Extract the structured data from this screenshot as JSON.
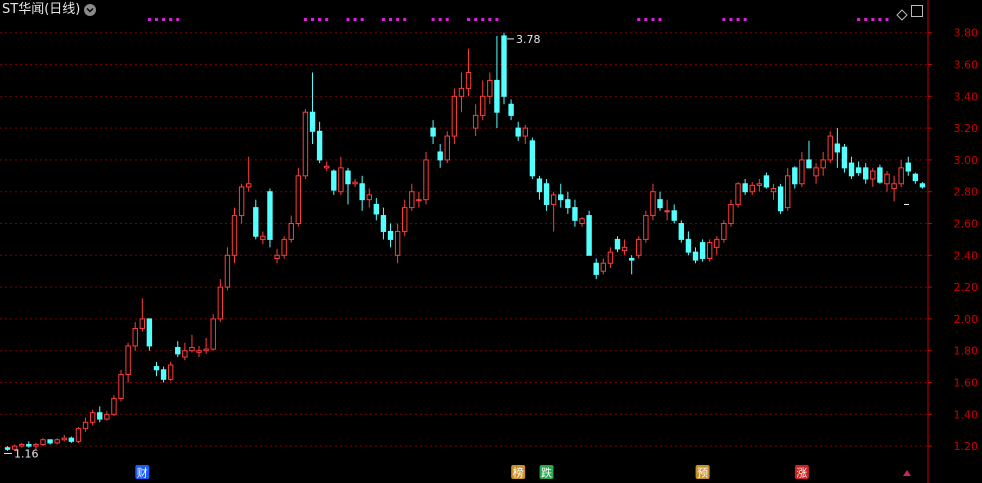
{
  "header": {
    "title": "ST华闻(日线)"
  },
  "colors": {
    "up": "#ff3c3c",
    "down": "#54ffff",
    "axis": "#cc0000",
    "grid": "#7a0000",
    "title": "#e6e6e6",
    "label": "#e6e6e6",
    "magenta": "#e020e0"
  },
  "chart_data": {
    "type": "candlestick",
    "title": "ST华闻(日线)",
    "ylim": [
      1.1,
      3.88
    ],
    "y_ticks": [
      "1.20",
      "1.40",
      "1.60",
      "1.80",
      "2.00",
      "2.20",
      "2.40",
      "2.60",
      "2.80",
      "3.00",
      "3.20",
      "3.40",
      "3.60",
      "3.80"
    ],
    "annotations": {
      "high_label": "3.78",
      "low_label": "1.16"
    },
    "event_markers": [
      "财",
      "榜",
      "跌",
      "预",
      "涨"
    ],
    "ohlc": [
      [
        1.19,
        1.2,
        1.17,
        1.18
      ],
      [
        1.18,
        1.21,
        1.17,
        1.2
      ],
      [
        1.2,
        1.22,
        1.19,
        1.21
      ],
      [
        1.21,
        1.23,
        1.19,
        1.2
      ],
      [
        1.2,
        1.22,
        1.18,
        1.21
      ],
      [
        1.21,
        1.25,
        1.2,
        1.24
      ],
      [
        1.24,
        1.23,
        1.21,
        1.22
      ],
      [
        1.22,
        1.25,
        1.21,
        1.24
      ],
      [
        1.24,
        1.27,
        1.23,
        1.25
      ],
      [
        1.25,
        1.26,
        1.22,
        1.23
      ],
      [
        1.23,
        1.32,
        1.22,
        1.31
      ],
      [
        1.31,
        1.38,
        1.29,
        1.35
      ],
      [
        1.35,
        1.43,
        1.33,
        1.41
      ],
      [
        1.41,
        1.45,
        1.35,
        1.37
      ],
      [
        1.37,
        1.42,
        1.36,
        1.4
      ],
      [
        1.4,
        1.52,
        1.39,
        1.5
      ],
      [
        1.5,
        1.68,
        1.48,
        1.65
      ],
      [
        1.65,
        1.85,
        1.6,
        1.83
      ],
      [
        1.83,
        1.98,
        1.8,
        1.94
      ],
      [
        1.94,
        2.13,
        1.92,
        2.0
      ],
      [
        2.0,
        1.95,
        1.8,
        1.83
      ],
      [
        1.7,
        1.73,
        1.64,
        1.68
      ],
      [
        1.68,
        1.7,
        1.6,
        1.62
      ],
      [
        1.62,
        1.73,
        1.61,
        1.71
      ],
      [
        1.82,
        1.86,
        1.76,
        1.78
      ],
      [
        1.76,
        1.85,
        1.74,
        1.8
      ],
      [
        1.8,
        1.9,
        1.79,
        1.82
      ],
      [
        1.79,
        1.83,
        1.76,
        1.8
      ],
      [
        1.8,
        1.88,
        1.78,
        1.81
      ],
      [
        1.81,
        2.03,
        1.8,
        2.0
      ],
      [
        2.0,
        2.25,
        1.98,
        2.2
      ],
      [
        2.2,
        2.45,
        2.18,
        2.4
      ],
      [
        2.4,
        2.7,
        2.35,
        2.65
      ],
      [
        2.65,
        2.85,
        2.6,
        2.83
      ],
      [
        2.83,
        3.02,
        2.8,
        2.85
      ],
      [
        2.7,
        2.75,
        2.5,
        2.52
      ],
      [
        2.5,
        2.55,
        2.47,
        2.52
      ],
      [
        2.8,
        2.82,
        2.45,
        2.5
      ],
      [
        2.38,
        2.44,
        2.35,
        2.4
      ],
      [
        2.4,
        2.52,
        2.38,
        2.5
      ],
      [
        2.5,
        2.65,
        2.48,
        2.6
      ],
      [
        2.6,
        2.95,
        2.58,
        2.9
      ],
      [
        2.9,
        3.32,
        2.88,
        3.3
      ],
      [
        3.3,
        3.55,
        3.1,
        3.18
      ],
      [
        3.18,
        3.24,
        2.98,
        3.0
      ],
      [
        2.95,
        2.99,
        2.93,
        2.96
      ],
      [
        2.93,
        2.94,
        2.78,
        2.81
      ],
      [
        2.8,
        3.02,
        2.78,
        2.95
      ],
      [
        2.93,
        2.95,
        2.72,
        2.85
      ],
      [
        2.85,
        2.88,
        2.83,
        2.86
      ],
      [
        2.85,
        2.9,
        2.68,
        2.75
      ],
      [
        2.75,
        2.82,
        2.7,
        2.78
      ],
      [
        2.72,
        2.76,
        2.62,
        2.66
      ],
      [
        2.65,
        2.7,
        2.5,
        2.55
      ],
      [
        2.55,
        2.6,
        2.45,
        2.5
      ],
      [
        2.4,
        2.6,
        2.35,
        2.55
      ],
      [
        2.55,
        2.75,
        2.52,
        2.7
      ],
      [
        2.7,
        2.85,
        2.68,
        2.8
      ],
      [
        2.75,
        2.8,
        2.7,
        2.75
      ],
      [
        2.75,
        3.05,
        2.72,
        3.0
      ],
      [
        3.2,
        3.25,
        3.1,
        3.15
      ],
      [
        3.05,
        3.1,
        2.95,
        3.0
      ],
      [
        3.0,
        3.18,
        2.98,
        3.15
      ],
      [
        3.15,
        3.45,
        3.1,
        3.4
      ],
      [
        3.4,
        3.55,
        3.3,
        3.45
      ],
      [
        3.45,
        3.7,
        3.4,
        3.55
      ],
      [
        3.2,
        3.35,
        3.15,
        3.28
      ],
      [
        3.28,
        3.5,
        3.25,
        3.4
      ],
      [
        3.4,
        3.55,
        3.35,
        3.5
      ],
      [
        3.5,
        3.78,
        3.2,
        3.3
      ],
      [
        3.78,
        3.8,
        3.35,
        3.4
      ],
      [
        3.35,
        3.38,
        3.25,
        3.28
      ],
      [
        3.2,
        3.24,
        3.12,
        3.15
      ],
      [
        3.15,
        3.22,
        3.1,
        3.2
      ],
      [
        3.12,
        3.14,
        2.88,
        2.9
      ],
      [
        2.88,
        2.9,
        2.75,
        2.8
      ],
      [
        2.85,
        2.88,
        2.68,
        2.72
      ],
      [
        2.72,
        2.8,
        2.55,
        2.78
      ],
      [
        2.78,
        2.85,
        2.7,
        2.75
      ],
      [
        2.75,
        2.8,
        2.66,
        2.7
      ],
      [
        2.7,
        2.75,
        2.58,
        2.62
      ],
      [
        2.6,
        2.64,
        2.58,
        2.63
      ],
      [
        2.65,
        2.68,
        2.4,
        2.4
      ],
      [
        2.35,
        2.38,
        2.25,
        2.28
      ],
      [
        2.3,
        2.38,
        2.28,
        2.35
      ],
      [
        2.35,
        2.45,
        2.32,
        2.42
      ],
      [
        2.5,
        2.52,
        2.42,
        2.44
      ],
      [
        2.43,
        2.5,
        2.4,
        2.45
      ],
      [
        2.38,
        2.4,
        2.28,
        2.37
      ],
      [
        2.4,
        2.52,
        2.38,
        2.5
      ],
      [
        2.5,
        2.68,
        2.48,
        2.65
      ],
      [
        2.65,
        2.85,
        2.62,
        2.8
      ],
      [
        2.75,
        2.8,
        2.68,
        2.7
      ],
      [
        2.68,
        2.75,
        2.62,
        2.68
      ],
      [
        2.68,
        2.72,
        2.6,
        2.62
      ],
      [
        2.6,
        2.62,
        2.48,
        2.5
      ],
      [
        2.5,
        2.55,
        2.4,
        2.42
      ],
      [
        2.42,
        2.45,
        2.35,
        2.37
      ],
      [
        2.48,
        2.5,
        2.36,
        2.38
      ],
      [
        2.38,
        2.5,
        2.36,
        2.48
      ],
      [
        2.45,
        2.52,
        2.4,
        2.5
      ],
      [
        2.5,
        2.62,
        2.48,
        2.6
      ],
      [
        2.6,
        2.75,
        2.58,
        2.72
      ],
      [
        2.72,
        2.86,
        2.7,
        2.85
      ],
      [
        2.85,
        2.88,
        2.78,
        2.8
      ],
      [
        2.8,
        2.86,
        2.78,
        2.84
      ],
      [
        2.84,
        2.88,
        2.8,
        2.85
      ],
      [
        2.9,
        2.92,
        2.82,
        2.83
      ],
      [
        2.8,
        2.85,
        2.75,
        2.82
      ],
      [
        2.83,
        2.85,
        2.66,
        2.68
      ],
      [
        2.7,
        2.95,
        2.68,
        2.9
      ],
      [
        2.95,
        2.96,
        2.82,
        2.85
      ],
      [
        2.85,
        3.05,
        2.83,
        3.0
      ],
      [
        3.0,
        3.12,
        2.95,
        2.95
      ],
      [
        2.9,
        2.98,
        2.85,
        2.95
      ],
      [
        2.95,
        3.05,
        2.9,
        3.0
      ],
      [
        3.0,
        3.18,
        2.98,
        3.15
      ],
      [
        3.1,
        3.2,
        2.95,
        3.05
      ],
      [
        3.08,
        3.1,
        2.92,
        2.95
      ],
      [
        2.98,
        3.02,
        2.88,
        2.9
      ],
      [
        2.95,
        2.99,
        2.9,
        2.92
      ],
      [
        2.95,
        2.98,
        2.85,
        2.88
      ],
      [
        2.88,
        2.95,
        2.83,
        2.93
      ],
      [
        2.95,
        2.97,
        2.85,
        2.86
      ],
      [
        2.85,
        2.93,
        2.8,
        2.91
      ],
      [
        2.82,
        2.9,
        2.74,
        2.85
      ],
      [
        2.85,
        3.0,
        2.83,
        2.95
      ],
      [
        2.98,
        3.02,
        2.9,
        2.93
      ],
      [
        2.91,
        2.92,
        2.85,
        2.87
      ],
      [
        2.85,
        2.86,
        2.82,
        2.83
      ]
    ],
    "magenta_dot_groups": [
      [
        20,
        24
      ],
      [
        42,
        45
      ],
      [
        48,
        50
      ],
      [
        53,
        56
      ],
      [
        60,
        62
      ],
      [
        65,
        69
      ],
      [
        89,
        92
      ],
      [
        101,
        104
      ],
      [
        120,
        124
      ]
    ],
    "marker_positions": [
      [
        19,
        0
      ],
      [
        72,
        1
      ],
      [
        76,
        2
      ],
      [
        98,
        3
      ],
      [
        112,
        4
      ]
    ]
  }
}
